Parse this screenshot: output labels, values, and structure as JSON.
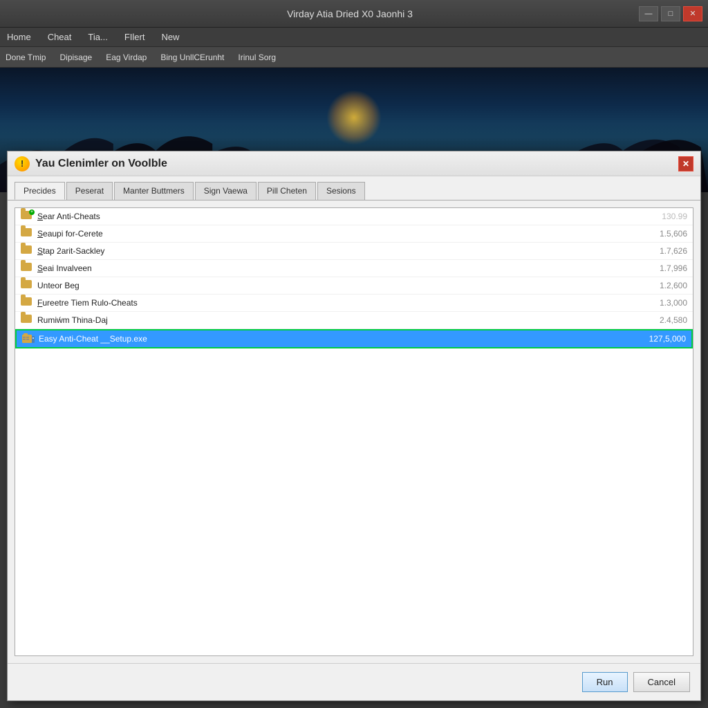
{
  "window": {
    "title": "Virday Atia Dried X0 Jaonhi 3",
    "minimize_label": "—",
    "maximize_label": "□",
    "close_label": "✕"
  },
  "menu": {
    "items": [
      {
        "label": "Home"
      },
      {
        "label": "Cheat"
      },
      {
        "label": "Tia..."
      },
      {
        "label": "FIlert"
      },
      {
        "label": "New"
      }
    ]
  },
  "toolbar": {
    "items": [
      {
        "label": "Done Tmip"
      },
      {
        "label": "Dipisage"
      },
      {
        "label": "Eag Virdap"
      },
      {
        "label": "Bing UnllCErunht"
      },
      {
        "label": "Irinul Sorg"
      }
    ]
  },
  "dialog": {
    "title": "Yau Clenimler on Voolble",
    "close_label": "✕",
    "tabs": [
      {
        "label": "Precides",
        "active": true
      },
      {
        "label": "Peserat"
      },
      {
        "label": "Manter Buttmers"
      },
      {
        "label": "Sign Vaewa"
      },
      {
        "label": "Pill Cheten"
      },
      {
        "label": "Sesions"
      }
    ],
    "files": [
      {
        "name": "Sear Anti-Cheats",
        "size": "130.99",
        "size_grey": true,
        "underline": "S",
        "selected": false,
        "has_green": true
      },
      {
        "name": "Seaupi for-Cerete",
        "size": "1.5,606",
        "selected": false,
        "underline": "S"
      },
      {
        "name": "Stap 2arit-Sackley",
        "size": "1.7,626",
        "selected": false,
        "underline": "S"
      },
      {
        "name": "Seai Invalveen",
        "size": "1.7,996",
        "selected": false,
        "underline": "S"
      },
      {
        "name": "Unteor Beg",
        "size": "1.2,600",
        "selected": false
      },
      {
        "name": "Fureetre Tiem Rulo-Cheats",
        "size": "1.3,000",
        "selected": false,
        "underline": "F"
      },
      {
        "name": "Rumiẃm Thina-Daj",
        "size": "2.4,580",
        "selected": false
      },
      {
        "name": "Easy Anti-Cheat __Setup.exe",
        "size": "127,5,000",
        "selected": true
      }
    ],
    "run_button": "Run",
    "cancel_button": "Cancel"
  }
}
